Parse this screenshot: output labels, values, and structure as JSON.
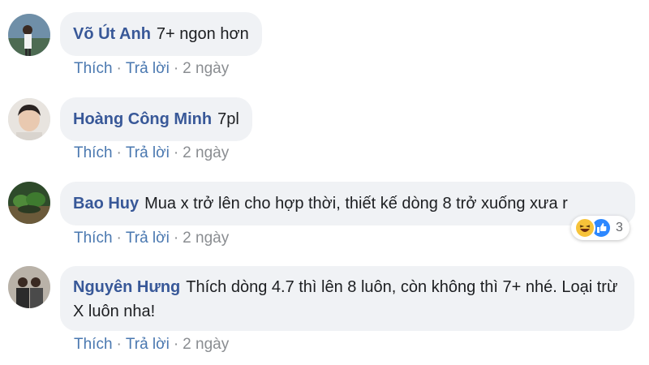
{
  "comments": [
    {
      "author": "Võ Út Anh",
      "text": "7+ ngon hơn",
      "actions": {
        "like": "Thích",
        "reply": "Trả lời",
        "time": "2 ngày"
      }
    },
    {
      "author": "Hoàng Công Minh",
      "text": "7pl",
      "actions": {
        "like": "Thích",
        "reply": "Trả lời",
        "time": "2 ngày"
      }
    },
    {
      "author": "Bao Huy",
      "text": "Mua x trở lên cho hợp thời, thiết kế dòng 8 trở xuống xưa r",
      "actions": {
        "like": "Thích",
        "reply": "Trả lời",
        "time": "2 ngày"
      },
      "reactions": {
        "icons": [
          "haha-icon",
          "like-icon"
        ],
        "count": "3"
      }
    },
    {
      "author": "Nguyên Hưng",
      "text": "Thích dòng 4.7 thì lên 8 luôn, còn không thì 7+ nhé. Loại trừ X luôn nha!",
      "actions": {
        "like": "Thích",
        "reply": "Trả lời",
        "time": "2 ngày"
      }
    }
  ],
  "separator": "·",
  "colors": {
    "bubble": "#f0f2f5",
    "author": "#385898",
    "action_link": "#4a78b0",
    "meta": "#8a8d91"
  }
}
